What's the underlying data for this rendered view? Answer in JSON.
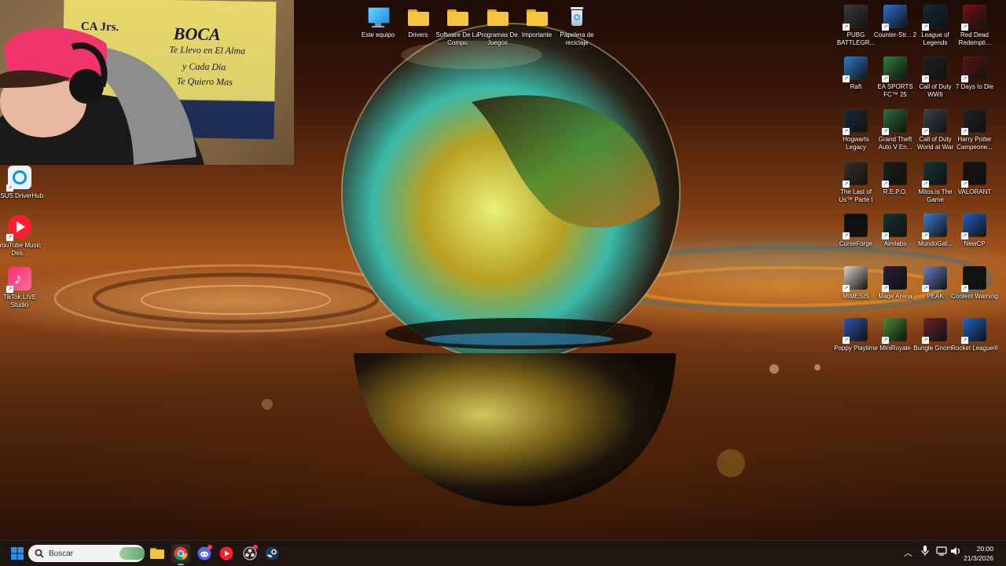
{
  "desktop": {
    "top_icons": [
      {
        "label": "Este equipo",
        "icon": "monitor-icon"
      },
      {
        "label": "Drivers",
        "icon": "folder-icon"
      },
      {
        "label": "Software De La Compu",
        "icon": "folder-icon"
      },
      {
        "label": "Programas De Juegos",
        "icon": "folder-icon"
      },
      {
        "label": "Importante",
        "icon": "folder-icon"
      },
      {
        "label": "Papelera de reciclaje",
        "icon": "recycle-bin-icon"
      }
    ],
    "left_icons": [
      {
        "label": "ASUS DriverHub",
        "icon": "asus-driverhub-icon"
      },
      {
        "label": "YouTube Music Des...",
        "icon": "youtube-music-icon"
      },
      {
        "label": "TikTok LIVE Studio",
        "icon": "tiktok-icon"
      }
    ],
    "right_icons": [
      {
        "label": "PUBG BATTLEGR...",
        "icon": "pubg-icon",
        "color": "#3a3a3a"
      },
      {
        "label": "Counter-Str... 2",
        "icon": "counter-strike-icon",
        "color": "#2d6fd1"
      },
      {
        "label": "League of Legends",
        "icon": "league-icon",
        "color": "#0d2b3a"
      },
      {
        "label": "Red Dead Redempti...",
        "icon": "red-dead-icon",
        "color": "#7a1010"
      },
      {
        "label": "Raft",
        "icon": "raft-icon",
        "color": "#2b7dc9"
      },
      {
        "label": "EA SPORTS FC™ 25",
        "icon": "ea-fc-icon",
        "color": "#2f7d3a"
      },
      {
        "label": "Call of Duty WWII",
        "icon": "cod-wwii-icon",
        "color": "#202020"
      },
      {
        "label": "7 Days to Die",
        "icon": "seven-days-icon",
        "color": "#5a1414"
      },
      {
        "label": "Hogwarts Legacy",
        "icon": "hogwarts-icon",
        "color": "#1a2a38"
      },
      {
        "label": "Grand Theft Auto V En...",
        "icon": "gta-icon",
        "color": "#2f6e3a"
      },
      {
        "label": "Call of Duty World at War",
        "icon": "cod-waw-icon",
        "color": "#384450"
      },
      {
        "label": "Harry Potter Campeone...",
        "icon": "harry-potter-icon",
        "color": "#222222"
      },
      {
        "label": "The Last of Us™ Parte I",
        "icon": "last-of-us-icon",
        "color": "#3b3026"
      },
      {
        "label": "R.E.P.O.",
        "icon": "repo-icon",
        "color": "#1c1c1c"
      },
      {
        "label": "Mitos.is The Game",
        "icon": "mitosis-icon",
        "color": "#13353a"
      },
      {
        "label": "VALORANT",
        "icon": "valorant-icon",
        "color": "#1a1212"
      },
      {
        "label": "CurseForge",
        "icon": "curseforge-icon",
        "color": "#111111"
      },
      {
        "label": "Aimlabs",
        "icon": "aimlabs-icon",
        "color": "#15342e"
      },
      {
        "label": "MundoGat...",
        "icon": "mundogato-icon",
        "color": "#3a7fd0"
      },
      {
        "label": "NewCP",
        "icon": "newcp-icon",
        "color": "#2060c0"
      },
      {
        "label": "MIMESIS",
        "icon": "mimesis-icon",
        "color": "#d8d2c8"
      },
      {
        "label": "Mage Arena",
        "icon": "mage-arena-icon",
        "color": "#26203a"
      },
      {
        "label": "PEAK",
        "icon": "peak-icon",
        "color": "#6a7fc0"
      },
      {
        "label": "Content Warning",
        "icon": "content-warning-icon",
        "color": "#141414"
      },
      {
        "label": "Poppy Playtime",
        "icon": "poppy-playtime-icon",
        "color": "#2a55b0"
      },
      {
        "label": "MiniRoyale",
        "icon": "miniroyale-icon",
        "color": "#4b8a30"
      },
      {
        "label": "Bungle Gnom...",
        "icon": "bungle-gnome-icon",
        "color": "#6a2228"
      },
      {
        "label": "Rocket League®",
        "icon": "rocket-league-icon",
        "color": "#1a66c8"
      }
    ]
  },
  "webcam": {
    "banner_title": "BOCA",
    "banner_corner": "CA Jrs.",
    "banner_lines": [
      "Te Llevo en El Alma",
      "y Cada Dia",
      "Te Quiero Mas"
    ]
  },
  "taskbar": {
    "search_placeholder": "Buscar",
    "time": "20:00",
    "date": "21/3/2026",
    "apps": [
      "file-explorer-icon",
      "chrome-icon",
      "discord-icon",
      "youtube-music-icon",
      "obs-icon",
      "steam-icon"
    ]
  },
  "colors": {
    "taskbar_bg": "#1f1612",
    "folder": "#f5c53d",
    "windows_blue": "#2b8ff0"
  }
}
